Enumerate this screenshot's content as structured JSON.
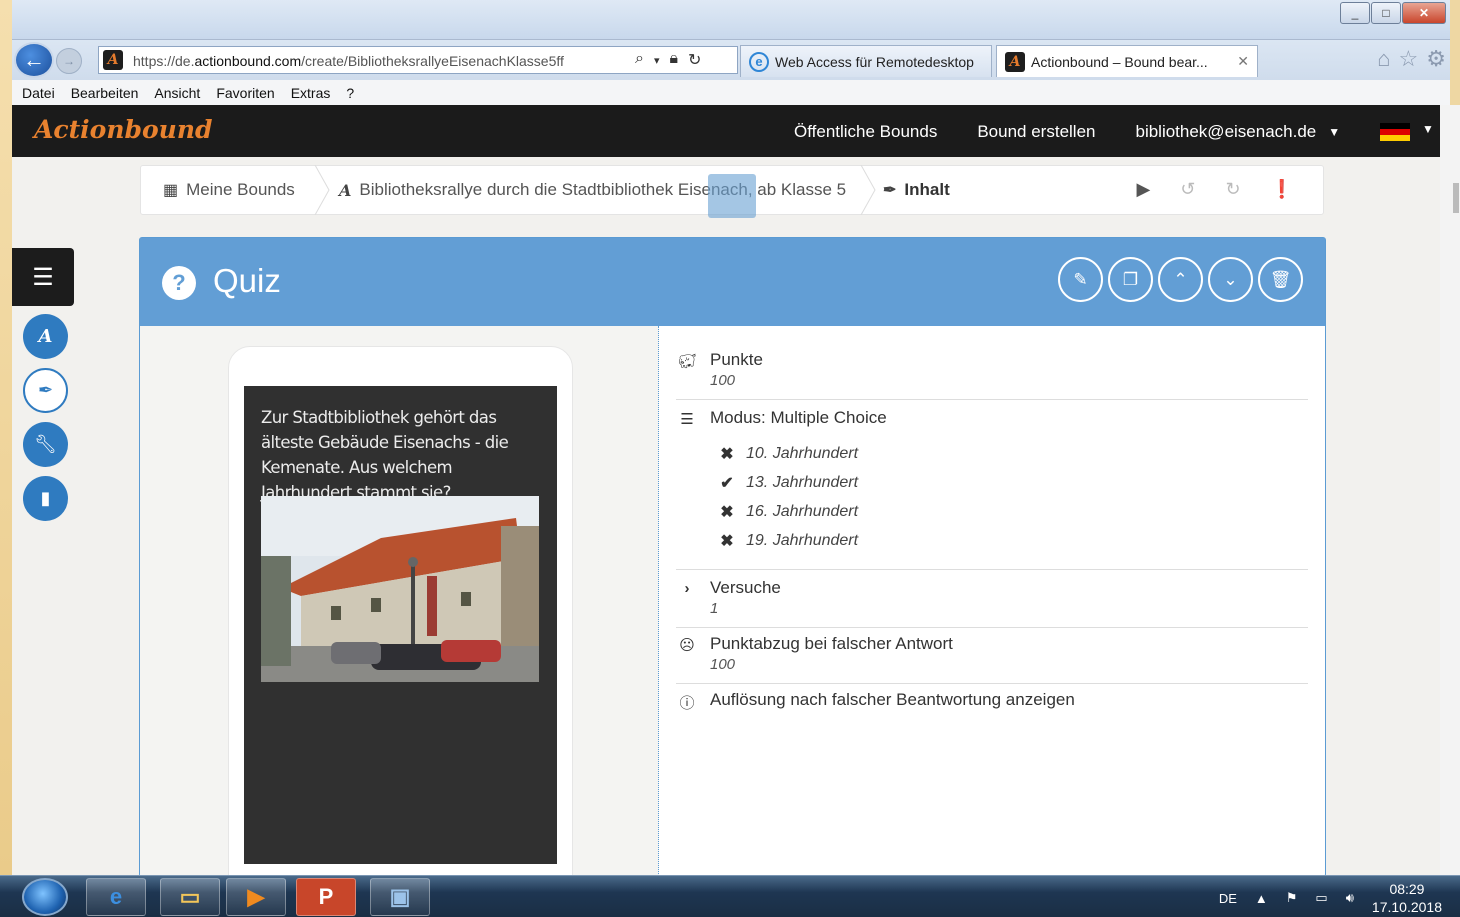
{
  "browser": {
    "address": {
      "url_prefix": "https://de.",
      "url_domain": "actionbound.com",
      "url_path": "/create/BibliotheksrallyeEisenachKlasse5ff"
    },
    "tabs": [
      {
        "label": "Web Access für Remotedesktop"
      },
      {
        "label": "Actionbound – Bound bear..."
      }
    ],
    "menu": [
      "Datei",
      "Bearbeiten",
      "Ansicht",
      "Favoriten",
      "Extras",
      "?"
    ]
  },
  "app": {
    "logo": "Actionbound",
    "nav": {
      "public_bounds": "Öffentliche Bounds",
      "create_bound": "Bound erstellen",
      "user_email": "bibliothek@eisenach.de"
    },
    "breadcrumbs": {
      "my_bounds": "Meine Bounds",
      "bound_title": "Bibliotheksrallye durch die Stadtbibliothek Eisenach, ab Klasse 5",
      "content": "Inhalt"
    },
    "quiz": {
      "title": "Quiz",
      "question": "Zur Stadtbibliothek gehört das älteste Gebäude Eisenachs - die Kemenate. Aus welchem Jahrhundert stammt sie?",
      "points_label": "Punkte",
      "points_value": "100",
      "mode_label": "Modus: Multiple Choice",
      "answers": [
        {
          "text": "10. Jahrhundert",
          "correct": false
        },
        {
          "text": "13. Jahrhundert",
          "correct": true
        },
        {
          "text": "16. Jahrhundert",
          "correct": false
        },
        {
          "text": "19. Jahrhundert",
          "correct": false
        }
      ],
      "attempts_label": "Versuche",
      "attempts_value": "1",
      "penalty_label": "Punktabzug bei falscher Antwort",
      "penalty_value": "100",
      "solution_label": "Auflösung nach falscher Beantwortung anzeigen"
    }
  },
  "taskbar": {
    "lang": "DE",
    "time": "08:29",
    "date": "17.10.2018"
  },
  "colors": {
    "accent": "#629ed5",
    "brand_orange": "#e9822f",
    "header_bg": "#1b1b1b"
  }
}
